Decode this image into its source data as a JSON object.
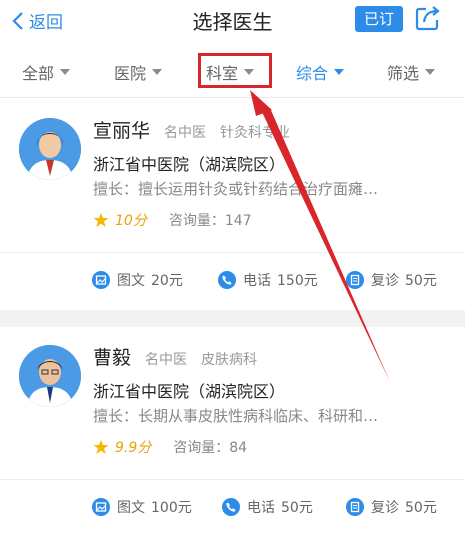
{
  "navbar": {
    "back_label": "返回",
    "title": "选择医生",
    "subscribed_label": "已订",
    "share_icon": "share-icon"
  },
  "filters": [
    {
      "label": "全部",
      "active": false
    },
    {
      "label": "医院",
      "active": false
    },
    {
      "label": "科室",
      "active": false,
      "highlighted": true
    },
    {
      "label": "综合",
      "active": true
    },
    {
      "label": "筛选",
      "active": false
    }
  ],
  "colors": {
    "accent": "#2d8ce8",
    "annotation_red": "#d9262a",
    "rating": "#e8a400"
  },
  "doctors": [
    {
      "name": "宣丽华",
      "title": "名中医",
      "department": "针灸科专业",
      "hospital": "浙江省中医院（湖滨院区）",
      "expertise": "擅长：擅长运用针灸或针药结合治疗面瘫…",
      "score": "10分",
      "consult_label": "咨询量：147",
      "services": [
        {
          "icon": "image-text-icon",
          "label": "图文",
          "price": "20元"
        },
        {
          "icon": "phone-icon",
          "label": "电话",
          "price": "150元"
        },
        {
          "icon": "revisit-icon",
          "label": "复诊",
          "price": "50元"
        }
      ]
    },
    {
      "name": "曹毅",
      "title": "名中医",
      "department": "皮肤病科",
      "hospital": "浙江省中医院（湖滨院区）",
      "expertise": "擅长：长期从事皮肤性病科临床、科研和…",
      "score": "9.9分",
      "consult_label": "咨询量：84",
      "services": [
        {
          "icon": "image-text-icon",
          "label": "图文",
          "price": "100元"
        },
        {
          "icon": "phone-icon",
          "label": "电话",
          "price": "50元"
        },
        {
          "icon": "revisit-icon",
          "label": "复诊",
          "price": "50元"
        }
      ]
    }
  ]
}
